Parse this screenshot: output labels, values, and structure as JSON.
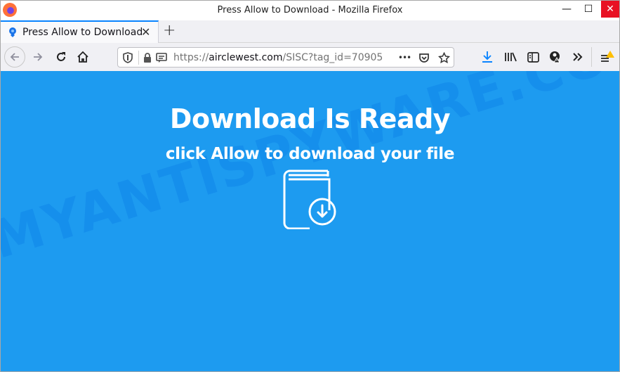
{
  "window": {
    "title": "Press Allow to Download - Mozilla Firefox",
    "minimize": "—",
    "maximize": "☐",
    "close": "✕"
  },
  "tabs": [
    {
      "label": "Press Allow to Download",
      "icon": "lightbulb-download-icon",
      "active": true,
      "close": "✕"
    }
  ],
  "new_tab": "+",
  "navbar": {
    "url_scheme": "https://",
    "url_host": "airclewest.com",
    "url_path": "/SISC?tag_id=70905",
    "more_actions": "•••"
  },
  "page": {
    "headline": "Download Is Ready",
    "subline": "click Allow to download your file",
    "icon": "book-download-icon",
    "background_color": "#1d9bf0",
    "watermark": "MYANTISPYWARE.COM"
  }
}
